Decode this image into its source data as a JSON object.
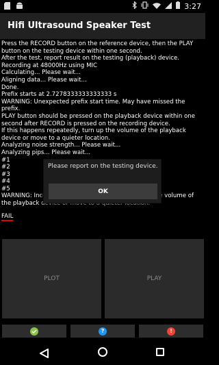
{
  "status_bar": {
    "time": "3:27",
    "left_icons": [
      "sd-card-icon",
      "android-icon"
    ],
    "right_icons": [
      "bluetooth-icon",
      "vibrate-icon",
      "wifi-icon",
      "signal-icon",
      "battery-icon"
    ]
  },
  "app": {
    "title": "Hifi Ultrasound Speaker Test"
  },
  "log": {
    "lines": [
      "Press the RECORD button on the reference device, then the PLAY button on the testing device within one second.",
      "After the test, report result on the testing (playback) device.",
      "Recording at 48000Hz using MIC",
      "Calculating... Please wait...",
      "Aligning data... Please wait...",
      "Done.",
      "Prefix starts at 2.7278333333333333 s",
      "WARNING: Unexpected prefix start time. May have missed the prefix.",
      "PLAY button should be pressed on the playback device within one second after RECORD is pressed on the recording device.",
      "If this happens repeatedly, turn up the volume of the playback device or move to a quieter location.",
      "Analyzing noise strength... Please wait...",
      "Analyzing pips... Please wait...",
      "#1",
      "#2",
      "#3",
      "#4",
      "#5",
      "WARNING: Inconsistent result across trials. Turn up the volume of the playback device or move to a quieter location."
    ],
    "result": "FAIL"
  },
  "buttons": {
    "plot": "PLOT",
    "play": "PLAY"
  },
  "result_buttons": {
    "pass_icon": "check-icon",
    "info_icon": "question-icon",
    "fail_icon": "exclamation-icon",
    "pass_color": "#8bc34a",
    "info_color": "#2196f3",
    "fail_color": "#f44336"
  },
  "dialog": {
    "message": "Please report on the testing device.",
    "ok": "OK"
  },
  "colors": {
    "action_bar": "#212121",
    "background": "#000000",
    "fail_underline": "#dd0000"
  }
}
